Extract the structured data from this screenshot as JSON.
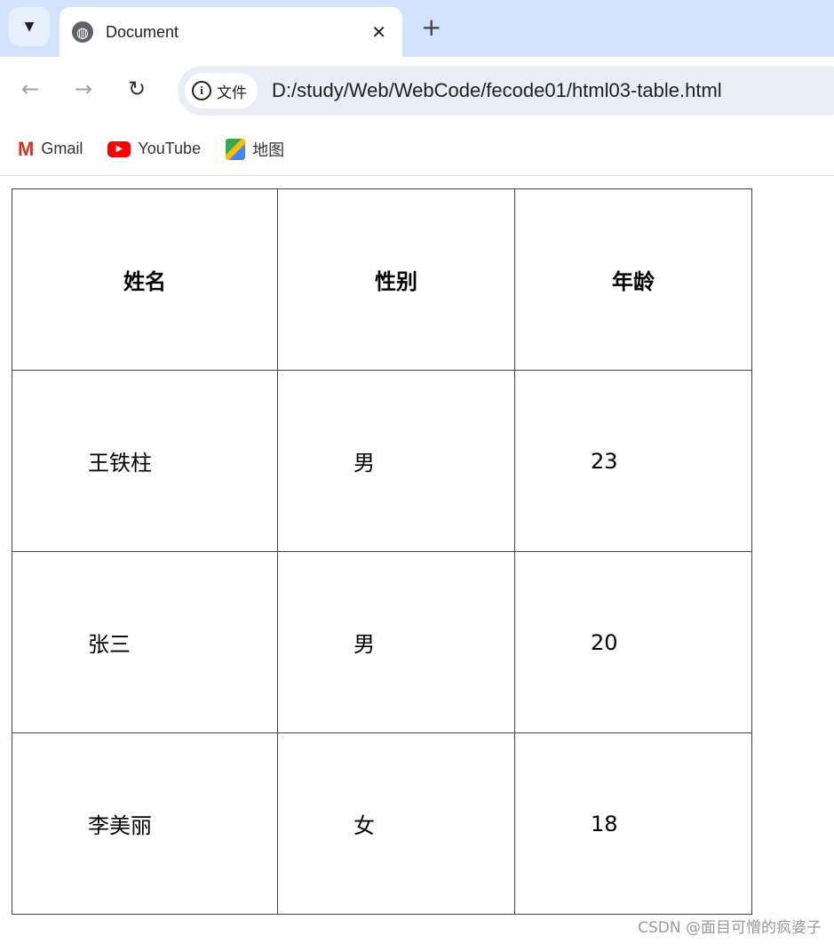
{
  "browser": {
    "tab_title": "Document",
    "address_chip": "文件",
    "url": "D:/study/Web/WebCode/fecode01/html03-table.html",
    "bookmarks": [
      {
        "label": "Gmail",
        "icon": "gmail-icon"
      },
      {
        "label": "YouTube",
        "icon": "youtube-icon"
      },
      {
        "label": "地图",
        "icon": "maps-icon"
      }
    ]
  },
  "table": {
    "headers": [
      "姓名",
      "性别",
      "年龄"
    ],
    "rows": [
      [
        "王铁柱",
        "男",
        "23"
      ],
      [
        "张三",
        "男",
        "20"
      ],
      [
        "李美丽",
        "女",
        "18"
      ]
    ]
  },
  "watermark": "CSDN @面目可憎的疯婆子"
}
